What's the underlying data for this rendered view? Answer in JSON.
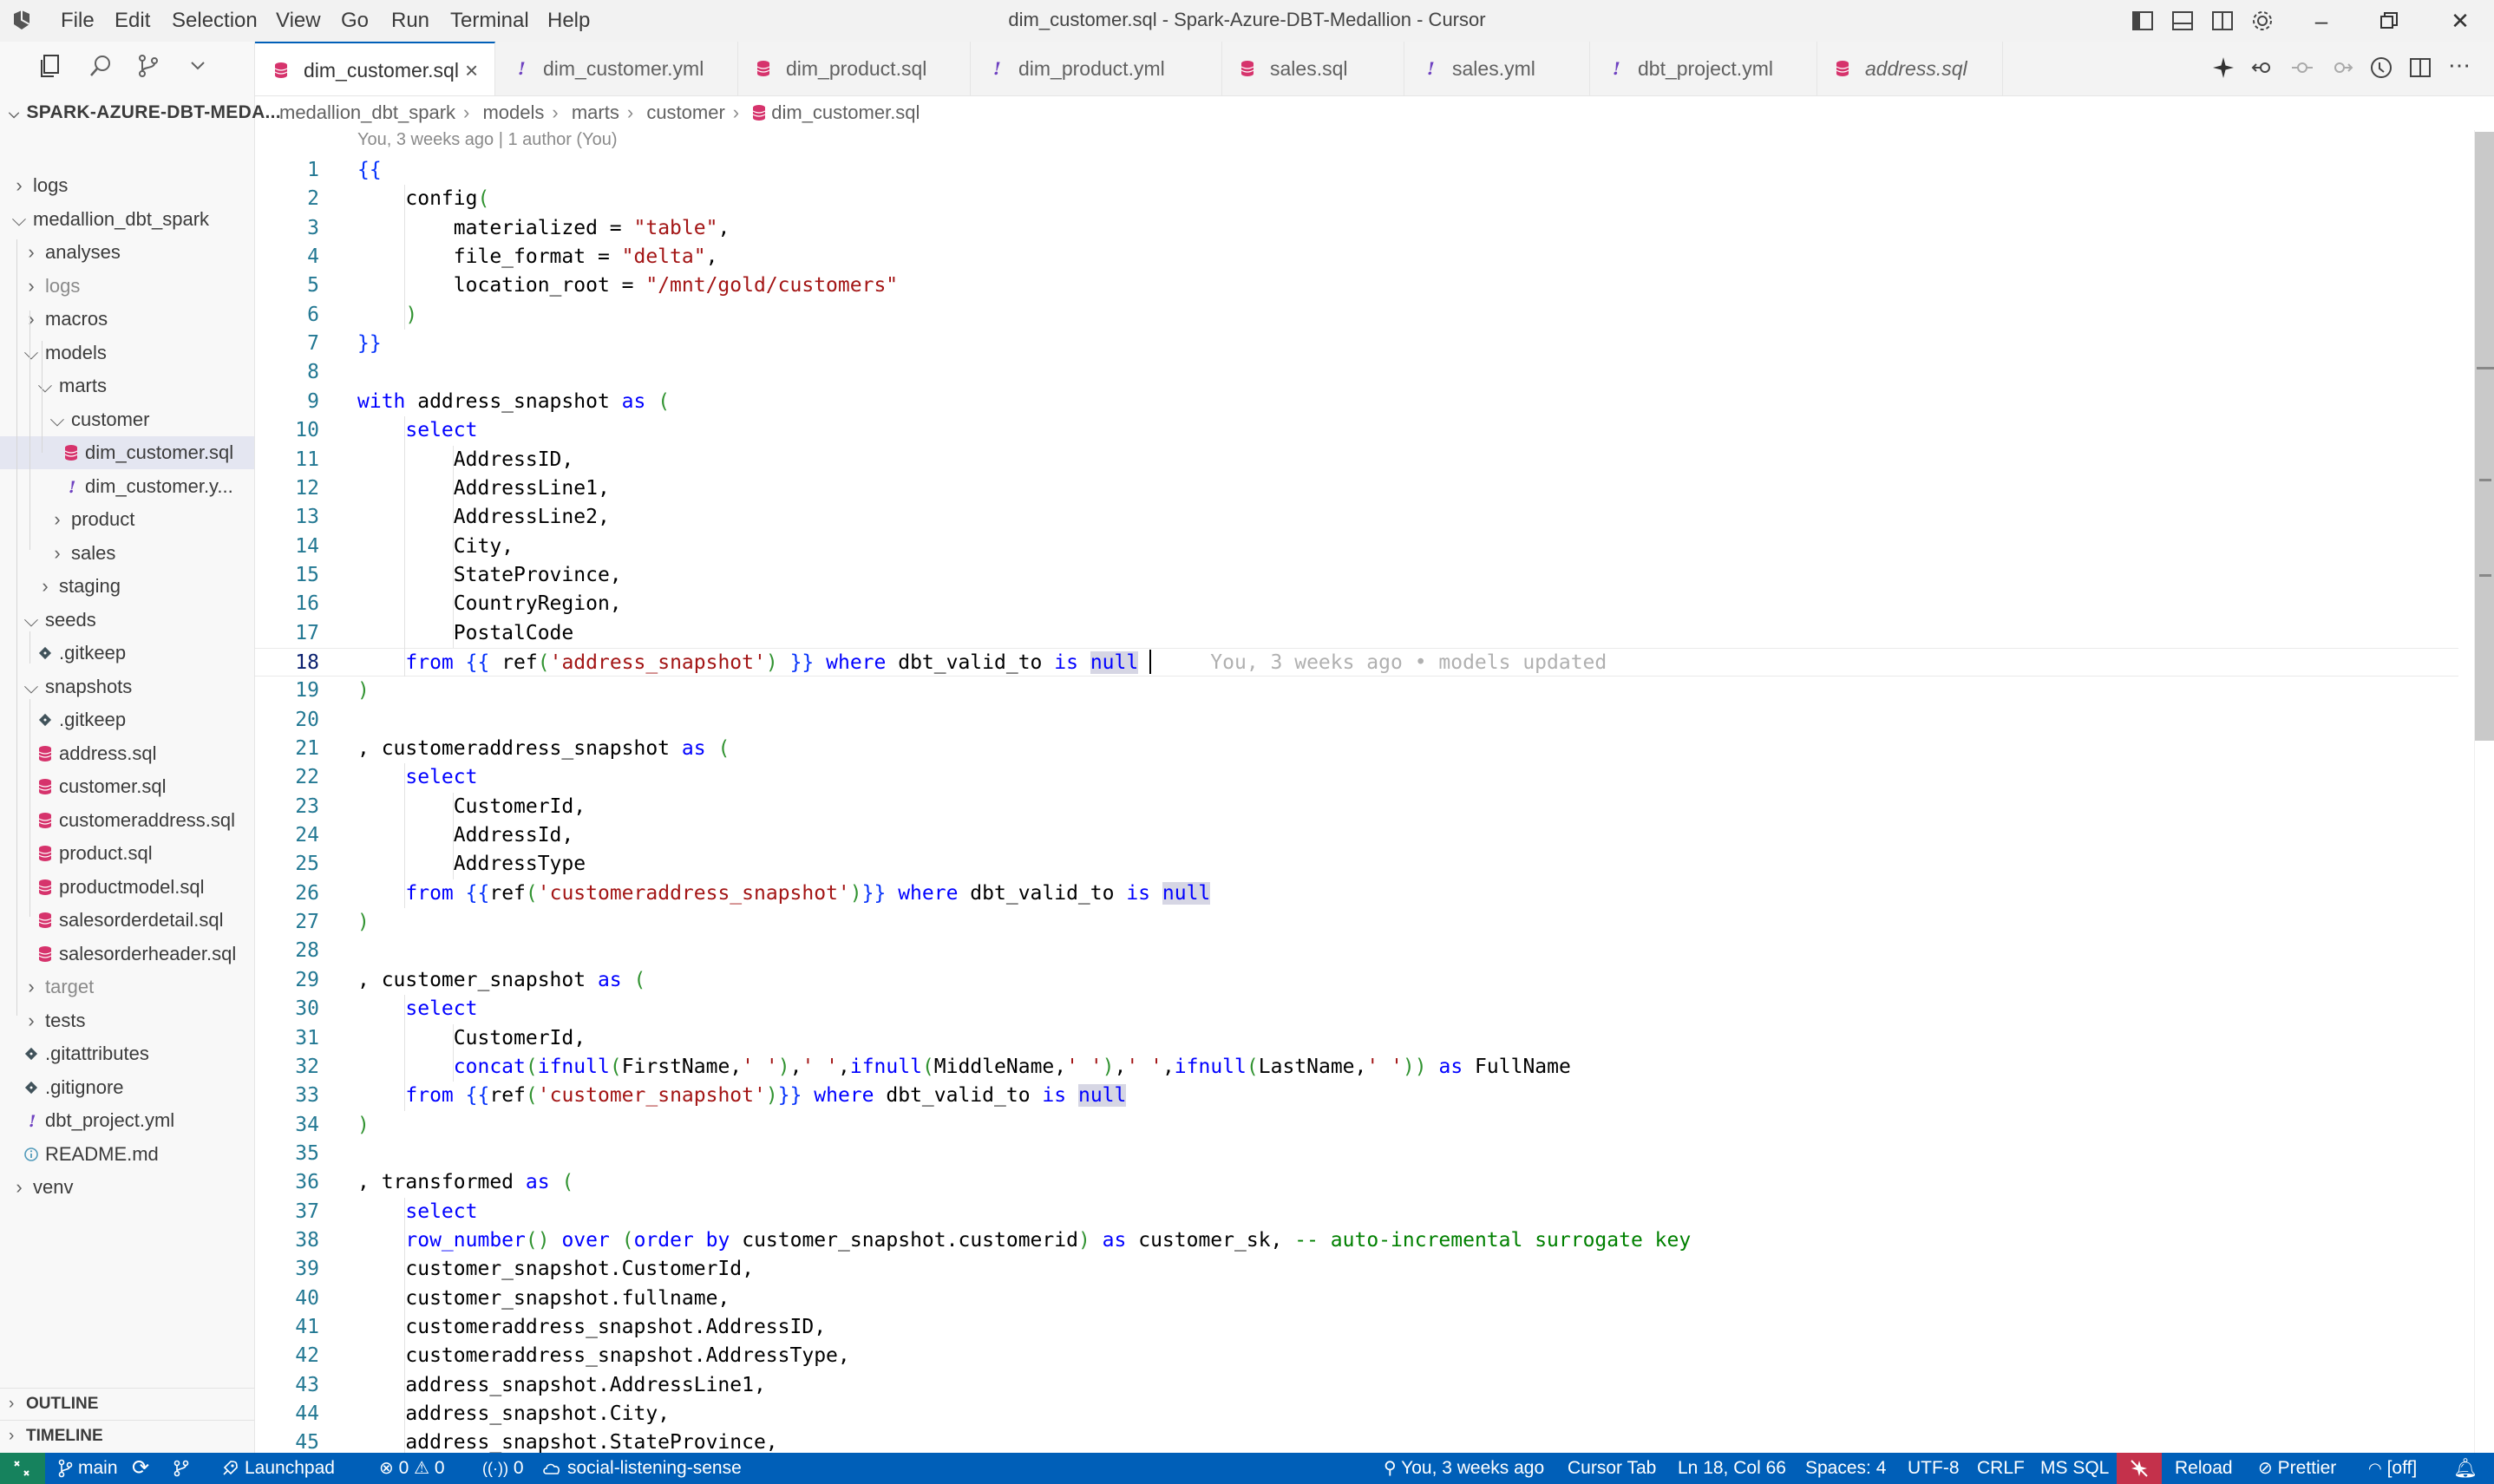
{
  "window": {
    "title": "dim_customer.sql - Spark-Azure-DBT-Medallion - Cursor",
    "menu": [
      "File",
      "Edit",
      "Selection",
      "View",
      "Go",
      "Run",
      "Terminal",
      "Help"
    ]
  },
  "sidebar": {
    "root_label": "SPARK-AZURE-DBT-MEDA...",
    "tree": [
      {
        "label": "logs",
        "kind": "folder",
        "open": false,
        "depth": 0
      },
      {
        "label": "medallion_dbt_spark",
        "kind": "folder",
        "open": true,
        "depth": 0
      },
      {
        "label": "analyses",
        "kind": "folder",
        "open": false,
        "depth": 1
      },
      {
        "label": "logs",
        "kind": "folder",
        "open": false,
        "depth": 1,
        "muted": true
      },
      {
        "label": "macros",
        "kind": "folder",
        "open": false,
        "depth": 1
      },
      {
        "label": "models",
        "kind": "folder",
        "open": true,
        "depth": 1
      },
      {
        "label": "marts",
        "kind": "folder",
        "open": true,
        "depth": 2
      },
      {
        "label": "customer",
        "kind": "folder",
        "open": true,
        "depth": 3
      },
      {
        "label": "dim_customer.sql",
        "kind": "sql",
        "depth": 4,
        "selected": true
      },
      {
        "label": "dim_customer.y...",
        "kind": "yml",
        "depth": 4
      },
      {
        "label": "product",
        "kind": "folder",
        "open": false,
        "depth": 3
      },
      {
        "label": "sales",
        "kind": "folder",
        "open": false,
        "depth": 3
      },
      {
        "label": "staging",
        "kind": "folder",
        "open": false,
        "depth": 2
      },
      {
        "label": "seeds",
        "kind": "folder",
        "open": true,
        "depth": 1
      },
      {
        "label": ".gitkeep",
        "kind": "git",
        "depth": 2
      },
      {
        "label": "snapshots",
        "kind": "folder",
        "open": true,
        "depth": 1
      },
      {
        "label": ".gitkeep",
        "kind": "git",
        "depth": 2
      },
      {
        "label": "address.sql",
        "kind": "sql",
        "depth": 2
      },
      {
        "label": "customer.sql",
        "kind": "sql",
        "depth": 2
      },
      {
        "label": "customeraddress.sql",
        "kind": "sql",
        "depth": 2
      },
      {
        "label": "product.sql",
        "kind": "sql",
        "depth": 2
      },
      {
        "label": "productmodel.sql",
        "kind": "sql",
        "depth": 2
      },
      {
        "label": "salesorderdetail.sql",
        "kind": "sql",
        "depth": 2
      },
      {
        "label": "salesorderheader.sql",
        "kind": "sql",
        "depth": 2
      },
      {
        "label": "target",
        "kind": "folder",
        "open": false,
        "depth": 1,
        "muted": true
      },
      {
        "label": "tests",
        "kind": "folder",
        "open": false,
        "depth": 1
      },
      {
        "label": ".gitattributes",
        "kind": "git",
        "depth": 1
      },
      {
        "label": ".gitignore",
        "kind": "git",
        "depth": 1
      },
      {
        "label": "dbt_project.yml",
        "kind": "yml",
        "depth": 1
      },
      {
        "label": "README.md",
        "kind": "info",
        "depth": 1
      },
      {
        "label": "venv",
        "kind": "folder",
        "open": false,
        "depth": 0
      }
    ],
    "outline_label": "OUTLINE",
    "timeline_label": "TIMELINE"
  },
  "tabs": [
    {
      "label": "dim_customer.sql",
      "kind": "sql",
      "active": true
    },
    {
      "label": "dim_customer.yml",
      "kind": "yml"
    },
    {
      "label": "dim_product.sql",
      "kind": "sql"
    },
    {
      "label": "dim_product.yml",
      "kind": "yml"
    },
    {
      "label": "sales.sql",
      "kind": "sql"
    },
    {
      "label": "sales.yml",
      "kind": "yml"
    },
    {
      "label": "dbt_project.yml",
      "kind": "yml"
    },
    {
      "label": "address.sql",
      "kind": "sql",
      "italic": true
    }
  ],
  "breadcrumb": [
    "medallion_dbt_spark",
    "models",
    "marts",
    "customer",
    "dim_customer.sql"
  ],
  "editor": {
    "blame_header": "You, 3 weeks ago | 1 author (You)",
    "inline_blame": "You, 3 weeks ago • models updated",
    "lines": [
      "{{",
      "    config(",
      "        materialized = \"table\",",
      "        file_format = \"delta\",",
      "        location_root = \"/mnt/gold/customers\"",
      "    )",
      "}}",
      "",
      "with address_snapshot as (",
      "    select",
      "        AddressID,",
      "        AddressLine1,",
      "        AddressLine2,",
      "        City,",
      "        StateProvince,",
      "        CountryRegion,",
      "        PostalCode",
      "    from {{ ref('address_snapshot') }} where dbt_valid_to is null",
      ")",
      "",
      ", customeraddress_snapshot as (",
      "    select",
      "        CustomerId,",
      "        AddressId,",
      "        AddressType",
      "    from {{ref('customeraddress_snapshot')}} where dbt_valid_to is null",
      ")",
      "",
      ", customer_snapshot as (",
      "    select",
      "        CustomerId,",
      "        concat(ifnull(FirstName,' '),' ',ifnull(MiddleName,' '),' ',ifnull(LastName,' ')) as FullName",
      "    from {{ref('customer_snapshot')}} where dbt_valid_to is null",
      ")",
      "",
      ", transformed as (",
      "    select",
      "    row_number() over (order by customer_snapshot.customerid) as customer_sk, -- auto-incremental surrogate key",
      "    customer_snapshot.CustomerId,",
      "    customer_snapshot.fullname,",
      "    customeraddress_snapshot.AddressID,",
      "    customeraddress_snapshot.AddressType,",
      "    address_snapshot.AddressLine1,",
      "    address_snapshot.City,",
      "    address_snapshot.StateProvince,"
    ],
    "current_line": 18
  },
  "statusbar": {
    "branch": "main",
    "launchpad": "Launchpad",
    "errors": "0",
    "warnings": "0",
    "ports": "0",
    "project": "social-listening-sense",
    "blame": "You, 3 weeks ago",
    "cursor_tab": "Cursor Tab",
    "position": "Ln 18, Col 66",
    "spaces": "Spaces: 4",
    "encoding": "UTF-8",
    "eol": "CRLF",
    "language": "MS SQL",
    "reload": "Reload",
    "prettier": "Prettier",
    "off": "[off]"
  },
  "colors": {
    "accent": "#005fb8",
    "remote": "#16825d",
    "sql_icon": "#d6336c",
    "yml_icon": "#6f42c1"
  }
}
